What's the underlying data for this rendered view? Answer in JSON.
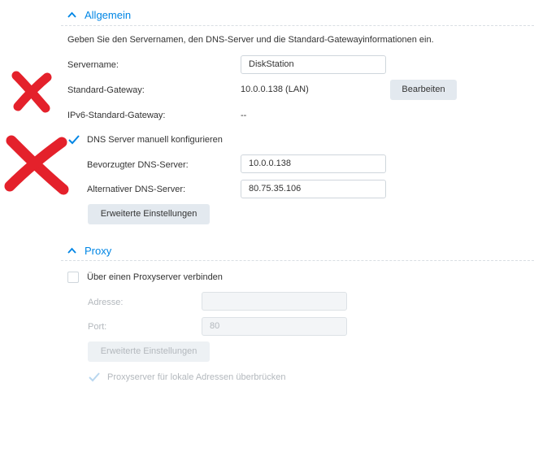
{
  "colors": {
    "accent": "#0086e5",
    "annotation_mark": "#e4212b",
    "disabled_text": "#b3b8bd"
  },
  "general": {
    "title": "Allgemein",
    "description": "Geben Sie den Servernamen, den DNS-Server und die Standard-Gatewayinformationen ein.",
    "server_name_label": "Servername:",
    "server_name_value": "DiskStation",
    "default_gateway_label": "Standard-Gateway:",
    "default_gateway_value": "10.0.0.138 (LAN)",
    "edit_button": "Bearbeiten",
    "ipv6_gateway_label": "IPv6-Standard-Gateway:",
    "ipv6_gateway_value": "--",
    "dns_manual_label": "DNS Server manuell konfigurieren",
    "dns_manual_checked": true,
    "preferred_dns_label": "Bevorzugter DNS-Server:",
    "preferred_dns_value": "10.0.0.138",
    "alternate_dns_label": "Alternativer DNS-Server:",
    "alternate_dns_value": "80.75.35.106",
    "advanced_button": "Erweiterte Einstellungen"
  },
  "proxy": {
    "title": "Proxy",
    "connect_label": "Über einen Proxyserver verbinden",
    "connect_checked": false,
    "address_label": "Adresse:",
    "address_value": "",
    "port_label": "Port:",
    "port_value": "80",
    "advanced_button": "Erweiterte Einstellungen",
    "bypass_label": "Proxyserver für lokale Adressen überbrücken",
    "bypass_checked": true
  }
}
